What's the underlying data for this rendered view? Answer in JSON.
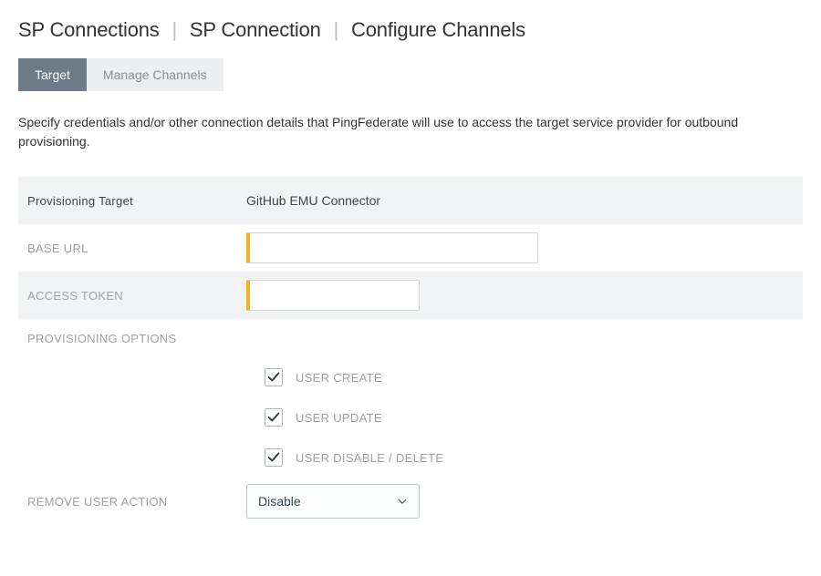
{
  "breadcrumb": {
    "items": [
      "SP Connections",
      "SP Connection",
      "Configure Channels"
    ]
  },
  "tabs": [
    {
      "label": "Target",
      "active": true
    },
    {
      "label": "Manage Channels",
      "active": false
    }
  ],
  "description": "Specify credentials and/or other connection details that PingFederate will use to access the target service provider for outbound provisioning.",
  "form": {
    "provisioning_target_label": "Provisioning Target",
    "provisioning_target_value": "GitHub EMU Connector",
    "base_url_label": "BASE URL",
    "base_url_value": "",
    "access_token_label": "ACCESS TOKEN",
    "access_token_value": "",
    "provisioning_options_label": "PROVISIONING OPTIONS",
    "options": {
      "user_create": {
        "label": "USER CREATE",
        "checked": true
      },
      "user_update": {
        "label": "USER UPDATE",
        "checked": true
      },
      "user_disable_delete": {
        "label": "USER DISABLE / DELETE",
        "checked": true
      }
    },
    "remove_user_action_label": "REMOVE USER ACTION",
    "remove_user_action_value": "Disable"
  }
}
